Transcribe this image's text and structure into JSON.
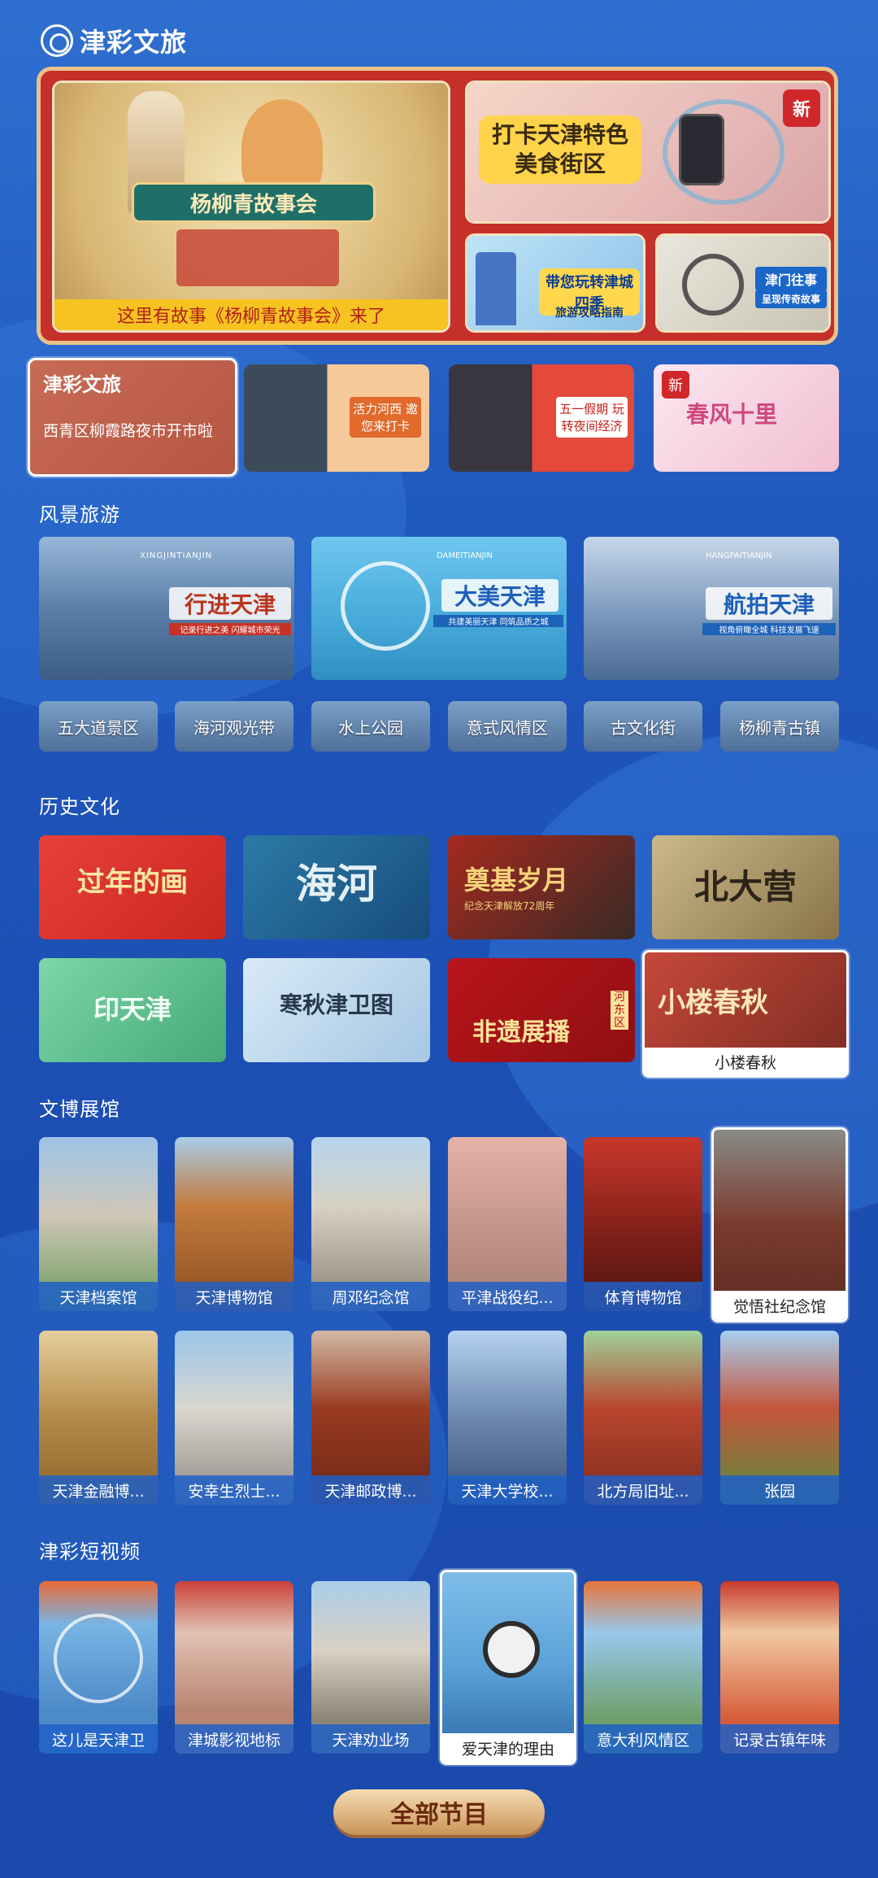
{
  "header": {
    "title": "津彩文旅"
  },
  "hero": {
    "main_caption": "这里有故事《杨柳青故事会》来了",
    "main_banner": "杨柳青故事会",
    "tile_food": "打卡天津特色美食街区",
    "tile_seasons": "带您玩转津城四季",
    "tile_seasons_sub": "旅游攻略指南",
    "tile_story": "津门往事",
    "tile_story_sub": "呈现传奇故事",
    "new_tag": "新"
  },
  "headline": {
    "selected_title": "津彩文旅",
    "selected_desc": "西青区柳霞路夜市开市啦",
    "card2_text": "活力河西 邀您来打卡",
    "card3_text": "五一假期 玩转夜间经济",
    "card4_text": "春风十里"
  },
  "scenic": {
    "title": "风景旅游",
    "banners": [
      {
        "title": "行进天津",
        "pinyin": "XINGJINTIANJIN",
        "sub": "记录行进之美 闪耀城市荣光"
      },
      {
        "title": "大美天津",
        "pinyin": "DAMEITIANJIN",
        "sub": "共建美丽天津 同筑品质之城"
      },
      {
        "title": "航拍天津",
        "pinyin": "HANGPAITIANJIN",
        "sub": "视角俯瞰全城 科技发展飞速"
      }
    ],
    "chips": [
      "五大道景区",
      "海河观光带",
      "水上公园",
      "意式风情区",
      "古文化街",
      "杨柳青古镇"
    ]
  },
  "history": {
    "title": "历史文化",
    "row1": [
      "过年的画",
      "海河",
      "奠基岁月",
      "北大营"
    ],
    "row2": [
      "印天津",
      "寒秋津卫图",
      "非遗展播",
      "小楼春秋"
    ],
    "selected_label": "小楼春秋",
    "sub_text": "纪念天津解放72周年",
    "district": "河东区"
  },
  "museums": {
    "title": "文博展馆",
    "row1": [
      "天津档案馆",
      "天津博物馆",
      "周邓纪念馆",
      "平津战役纪...",
      "体育博物馆",
      "觉悟社纪念馆"
    ],
    "row2": [
      "天津金融博...",
      "安幸生烈士...",
      "天津邮政博...",
      "天津大学校...",
      "北方局旧址...",
      "张园"
    ]
  },
  "videos": {
    "title": "津彩短视频",
    "items": [
      "这儿是天津卫",
      "津城影视地标",
      "天津劝业场",
      "爱天津的理由",
      "意大利风情区",
      "记录古镇年味"
    ]
  },
  "footer": {
    "all_programs": "全部节目"
  },
  "colors": {
    "bg": "#1f57bd",
    "red": "#c5302b",
    "gold": "#e9c28b",
    "label_blue": "#1e5fc8"
  }
}
